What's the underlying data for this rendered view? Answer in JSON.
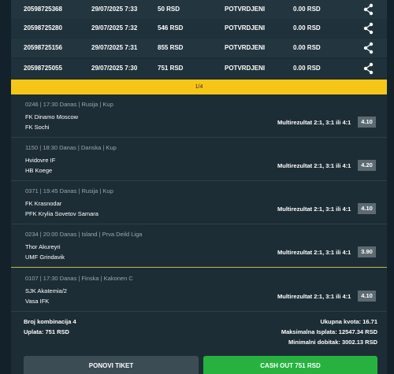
{
  "tickets": [
    {
      "id": "20598725368",
      "date": "29/07/2025 7:33",
      "amount": "50 RSD",
      "status": "POTVRDJENI",
      "win": "0.00 RSD",
      "share_icon": "share-icon"
    },
    {
      "id": "20598725280",
      "date": "29/07/2025 7:32",
      "amount": "546 RSD",
      "status": "POTVRDJENI",
      "win": "0.00 RSD",
      "share_icon": "share-icon"
    },
    {
      "id": "20598725156",
      "date": "29/07/2025 7:31",
      "amount": "855 RSD",
      "status": "POTVRDJENI",
      "win": "0.00 RSD",
      "share_icon": "share-icon"
    },
    {
      "id": "20598725055",
      "date": "29/07/2025 7:30",
      "amount": "751 RSD",
      "status": "POTVRDJENI",
      "win": "0.00 RSD",
      "share_icon": "share-icon"
    }
  ],
  "pager": {
    "label": "1/4"
  },
  "matches": [
    {
      "header": "0246 | 17:30 Danas | Rusija | Kup",
      "home": "FK Dinamo Moscow",
      "away": "FK Sochi",
      "market": "Multirezultat 2:1, 3:1 ili 4:1",
      "odd": "4.10"
    },
    {
      "header": "1150 | 18:30 Danas | Danska | Kup",
      "home": "Hvidovre IF",
      "away": "HB Koege",
      "market": "Multirezultat 2:1, 3:1 ili 4:1",
      "odd": "4.20"
    },
    {
      "header": "0371 | 19:45 Danas | Rusija | Kup",
      "home": "FK Krasnodar",
      "away": "PFK Krylia Sovetov Samara",
      "market": "Multirezultat 2:1, 3:1 ili 4:1",
      "odd": "4.10"
    },
    {
      "header": "0234 | 20:00 Danas | Island | Prva Deild Liga",
      "home": "Thor Akureyri",
      "away": "UMF Grindavik",
      "market": "Multirezultat 2:1, 3:1 ili 4:1",
      "odd": "3.90"
    },
    {
      "header": "0107 | 17:30 Danas | Finska | Kakonen C",
      "home": "SJK Akatemia/2",
      "away": "Vasa IFK",
      "market": "Multirezultat 2:1, 3:1 ili 4:1",
      "odd": "4.10"
    }
  ],
  "summary": {
    "combinations": "Broj kombinacija 4",
    "stake": "Uplata: 751 RSD",
    "total_odds": "Ukupna kvota: 16.71",
    "max_payout": "Maksimalna Isplata: 12547.34 RSD",
    "min_win": "Minimalni dobitak: 3002.13 RSD"
  },
  "buttons": {
    "repeat": "PONOVI TIKET",
    "cashout": "CASH OUT 751 RSD"
  },
  "colors": {
    "background": "#1d2d35",
    "pager": "#f5c518",
    "cashout": "#27b240",
    "odd_badge": "#5c6b72"
  }
}
